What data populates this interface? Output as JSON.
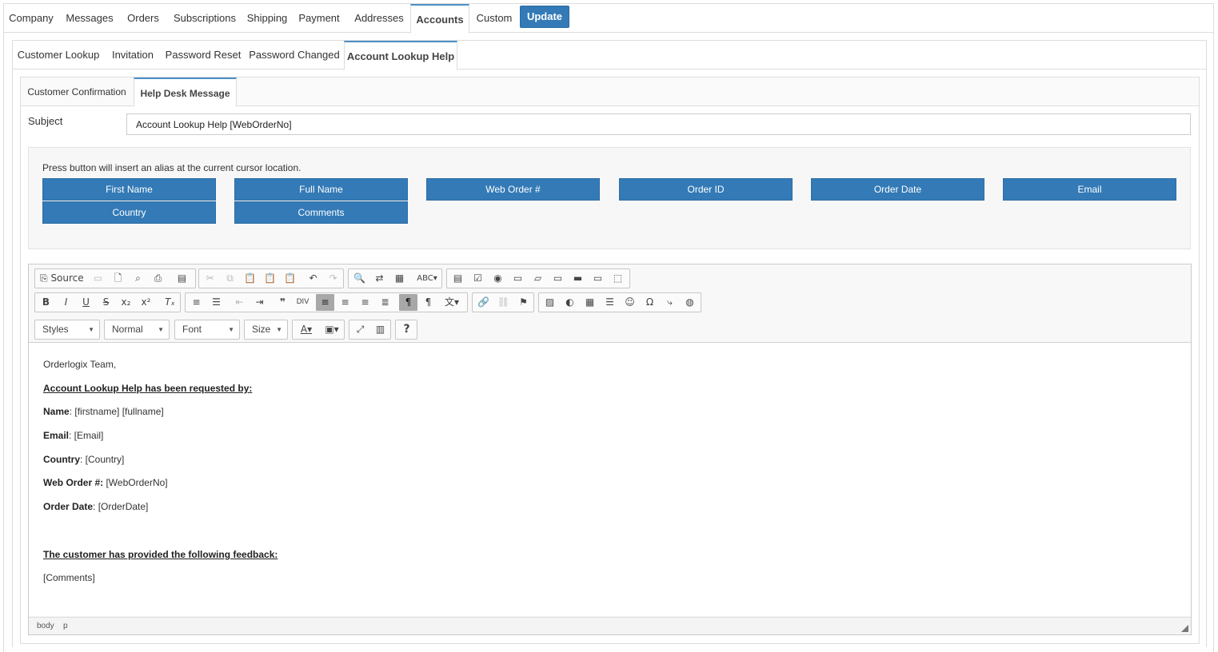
{
  "top_tabs": [
    "Company",
    "Messages",
    "Orders",
    "Subscriptions",
    "Shipping",
    "Payment",
    "Addresses",
    "Accounts",
    "Custom"
  ],
  "top_tab_active": "Accounts",
  "update_label": "Update",
  "sub_tabs": [
    "Customer Lookup",
    "Invitation",
    "Password Reset",
    "Password Changed",
    "Account Lookup Help"
  ],
  "sub_tab_active": "Account Lookup Help",
  "inner_tabs": [
    "Customer Confirmation",
    "Help Desk Message"
  ],
  "inner_tab_active": "Help Desk Message",
  "subject": {
    "label": "Subject",
    "value": "Account Lookup Help [WebOrderNo]"
  },
  "alias": {
    "hint": "Press button will insert an alias at the current cursor location.",
    "buttons": [
      "First Name",
      "Full Name",
      "Web Order #",
      "Order ID",
      "Order Date",
      "Email",
      "Country",
      "Comments"
    ]
  },
  "editor": {
    "source_label": "Source",
    "styles_label": "Styles",
    "format_label": "Normal",
    "font_label": "Font",
    "size_label": "Size",
    "greeting": "Orderlogix Team,",
    "heading1": "Account Lookup Help has been requested by:",
    "name_label": "Name",
    "name_value": ": [firstname] [fullname]",
    "email_label": "Email",
    "email_value": ": [Email]",
    "country_label": "Country",
    "country_value": ": [Country]",
    "weborder_label": "Web Order #:",
    "weborder_value": " [WebOrderNo]",
    "orderdate_label": "Order Date",
    "orderdate_value": ": [OrderDate]",
    "heading2": "The customer has provided the following feedback:",
    "comments": "[Comments]",
    "path": [
      "body",
      "p"
    ]
  },
  "colors": {
    "accent": "#337ab7",
    "tab_active_border": "#4a90c8"
  }
}
